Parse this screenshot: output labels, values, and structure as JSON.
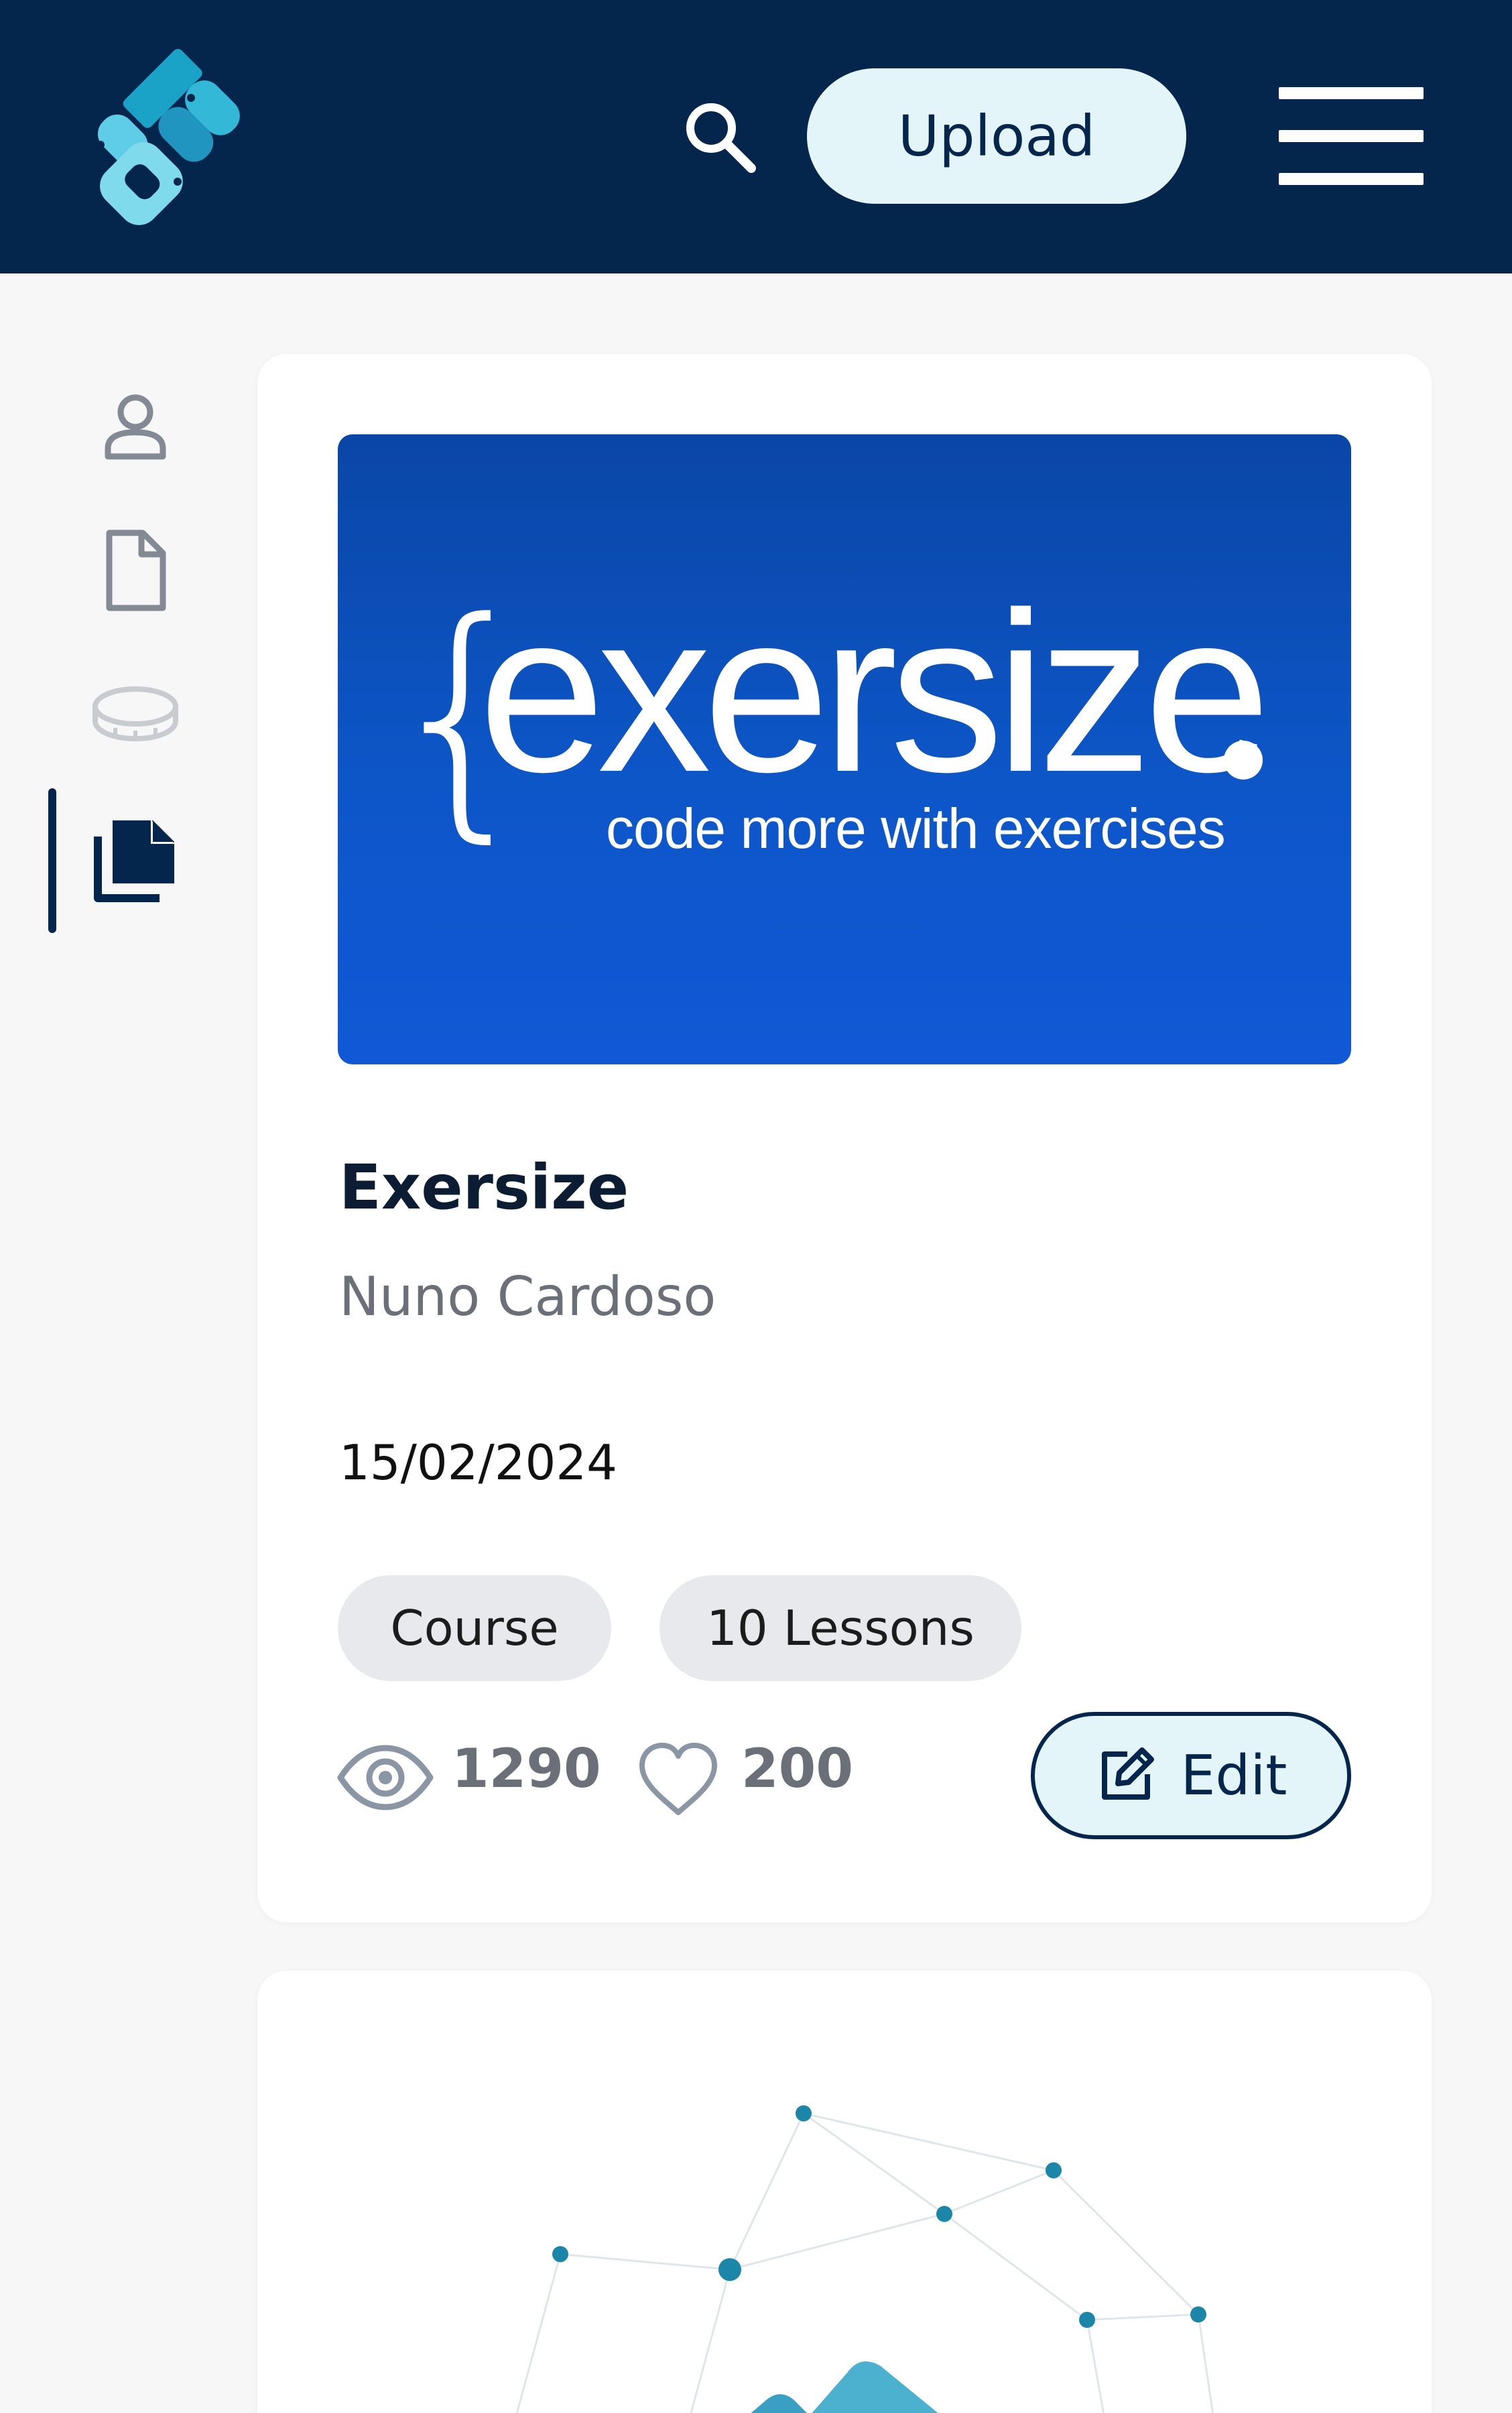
{
  "header": {
    "logo_icon": "app-logo",
    "search_icon": "search-icon",
    "upload_label": "Upload",
    "menu_icon": "hamburger-menu-icon"
  },
  "sidebar": {
    "items": [
      {
        "icon": "profile-icon",
        "active": false
      },
      {
        "icon": "document-icon",
        "active": false
      },
      {
        "icon": "coin-icon",
        "active": false
      },
      {
        "icon": "content-library-icon",
        "active": true
      }
    ]
  },
  "content": {
    "cards": [
      {
        "thumbnail": {
          "brace": "{",
          "word": "exersize",
          "tagline": "code more with exercises"
        },
        "title": "Exersize",
        "author": "Nuno Cardoso",
        "date": "15/02/2024",
        "tags": [
          "Course",
          "10 Lessons"
        ],
        "views": "1290",
        "likes": "200",
        "edit_label": "Edit"
      }
    ]
  },
  "colors": {
    "header_bg": "#05264c",
    "accent_light": "#e3f5f9",
    "page_bg": "#f7f7f7",
    "thumbnail_blue": "#0d56c8",
    "tag_bg": "#e7e9ec"
  }
}
